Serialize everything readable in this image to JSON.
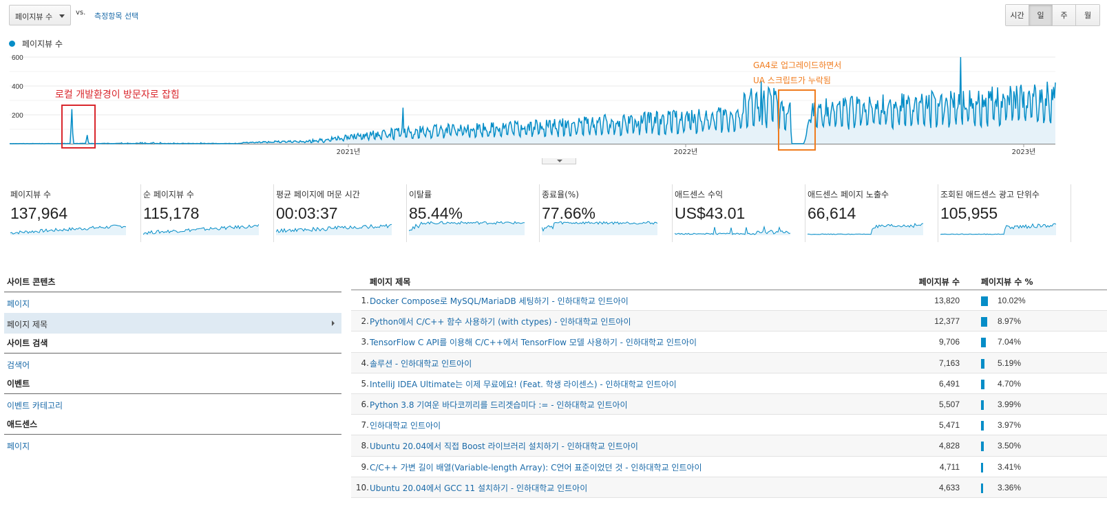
{
  "controls": {
    "metric_select": "페이지뷰 수",
    "vs_label": "vs.",
    "compare_link": "측정항목 선택",
    "granularity": [
      {
        "label": "시간",
        "active": false
      },
      {
        "label": "일",
        "active": true
      },
      {
        "label": "주",
        "active": false
      },
      {
        "label": "월",
        "active": false
      }
    ]
  },
  "legend": {
    "label": "페이지뷰 수",
    "color": "#058dc7"
  },
  "annotations": {
    "local_dev": "로컬 개발환경이 방문자로 잡힘",
    "ga4_line1": "GA4로 업그레이드하면서",
    "ga4_line2": "UA 스크립트가 누락됨"
  },
  "chart_data": {
    "type": "area",
    "series": [
      {
        "name": "페이지뷰 수",
        "color": "#058dc7"
      }
    ],
    "x_tick_labels": [
      "2021년",
      "2022년",
      "2023년"
    ],
    "y_tick_labels": [
      "600",
      "400",
      "200"
    ],
    "ylim": [
      0,
      600
    ],
    "grid": true,
    "segments": [
      {
        "from": "2020-01",
        "to": "2020-06",
        "level": "near 0",
        "spike": 240,
        "second_spike": 60
      },
      {
        "from": "2020-06",
        "to": "2020-10",
        "level": "near 0"
      },
      {
        "from": "2020-10",
        "to": "2021-01",
        "range": [
          5,
          40
        ]
      },
      {
        "from": "2021-01",
        "to": "2021-06",
        "range": [
          20,
          130
        ],
        "peak": 250
      },
      {
        "from": "2021-06",
        "to": "2022-03",
        "range": [
          60,
          250
        ]
      },
      {
        "from": "2022-03",
        "to": "2022-05",
        "range": [
          60,
          420
        ],
        "peak": 430
      },
      {
        "from": "2022-05",
        "to": "2022-06",
        "level": 0,
        "note": "GA4 migration gap"
      },
      {
        "from": "2022-06",
        "to": "2023-03",
        "range": [
          100,
          450
        ],
        "peak": 600
      }
    ],
    "highlight_boxes": [
      {
        "color": "#d9262c",
        "label": "로컬 개발환경이 방문자로 잡힘"
      },
      {
        "color": "#f07b1d",
        "label": "GA4로 업그레이드하면서 UA 스크립트가 누락됨"
      }
    ]
  },
  "scorecards": [
    {
      "label": "페이지뷰 수",
      "value": "137,964"
    },
    {
      "label": "순 페이지뷰 수",
      "value": "115,178"
    },
    {
      "label": "평균 페이지에 머문 시간",
      "value": "00:03:37"
    },
    {
      "label": "이탈률",
      "value": "85.44%"
    },
    {
      "label": "종료율(%)",
      "value": "77.66%"
    },
    {
      "label": "애드센스 수익",
      "value": "US$43.01"
    },
    {
      "label": "애드센스 페이지 노출수",
      "value": "66,614"
    },
    {
      "label": "조회된 애드센스 광고 단위수",
      "value": "105,955"
    }
  ],
  "nav": {
    "site_content": "사이트 콘텐츠",
    "page": "페이지",
    "page_title": "페이지 제목",
    "site_search": "사이트 검색",
    "search_term": "검색어",
    "events": "이벤트",
    "event_category": "이벤트 카테고리",
    "adsense": "애드센스",
    "adsense_page": "페이지"
  },
  "table": {
    "col_title": "페이지 제목",
    "col_views": "페이지뷰 수",
    "col_pct": "페이지뷰 수 %",
    "rows": [
      {
        "idx": "1.",
        "title": "Docker Compose로 MySQL/MariaDB 세팅하기 - 인하대학교 인트아이",
        "views": "13,820",
        "pct": "10.02%",
        "pct_value": 10.02
      },
      {
        "idx": "2.",
        "title": "Python에서 C/C++ 함수 사용하기 (with ctypes) - 인하대학교 인트아이",
        "views": "12,377",
        "pct": "8.97%",
        "pct_value": 8.97
      },
      {
        "idx": "3.",
        "title": "TensorFlow C API를 이용해 C/C++에서 TensorFlow 모델 사용하기 - 인하대학교 인트아이",
        "views": "9,706",
        "pct": "7.04%",
        "pct_value": 7.04
      },
      {
        "idx": "4.",
        "title": "솔루션 - 인하대학교 인트아이",
        "views": "7,163",
        "pct": "5.19%",
        "pct_value": 5.19
      },
      {
        "idx": "5.",
        "title": "IntelliJ IDEA Ultimate는 이제 무료에요! (Feat. 학생 라이센스) - 인하대학교 인트아이",
        "views": "6,491",
        "pct": "4.70%",
        "pct_value": 4.7
      },
      {
        "idx": "6.",
        "title": "Python 3.8 기여운 바다코끼리를 드리겟습미다 := - 인하대학교 인트아이",
        "views": "5,507",
        "pct": "3.99%",
        "pct_value": 3.99
      },
      {
        "idx": "7.",
        "title": "인하대학교 인트아이",
        "views": "5,471",
        "pct": "3.97%",
        "pct_value": 3.97
      },
      {
        "idx": "8.",
        "title": "Ubuntu 20.04에서 직접 Boost 라이브러리 설치하기 - 인하대학교 인트아이",
        "views": "4,828",
        "pct": "3.50%",
        "pct_value": 3.5
      },
      {
        "idx": "9.",
        "title": "C/C++ 가변 길이 배열(Variable-length Array): C언어 표준이었던 것 - 인하대학교 인트아이",
        "views": "4,711",
        "pct": "3.41%",
        "pct_value": 3.41
      },
      {
        "idx": "10.",
        "title": "Ubuntu 20.04에서 GCC 11 설치하기 - 인하대학교 인트아이",
        "views": "4,633",
        "pct": "3.36%",
        "pct_value": 3.36
      }
    ]
  }
}
